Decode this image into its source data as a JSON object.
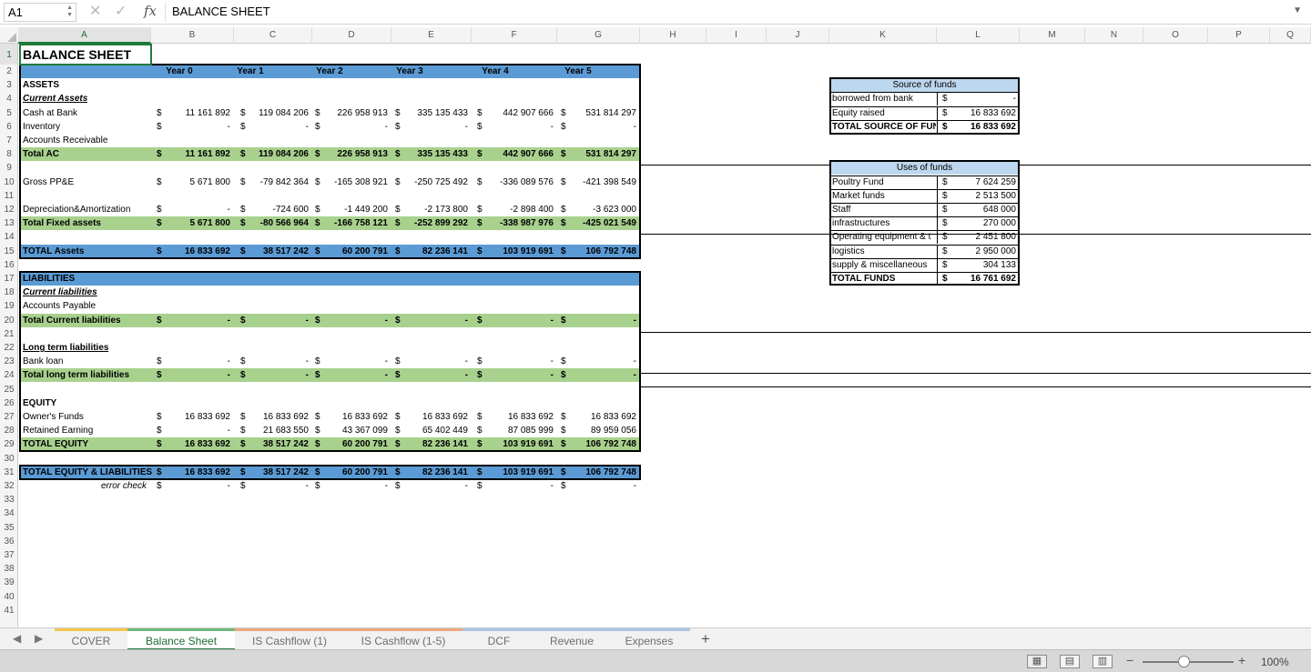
{
  "formula_bar": {
    "cell_ref": "A1",
    "fx": "fx",
    "value": "BALANCE SHEET"
  },
  "columns": [
    "A",
    "B",
    "C",
    "D",
    "E",
    "F",
    "G",
    "H",
    "I",
    "J",
    "K",
    "L",
    "M",
    "N",
    "O",
    "P",
    "Q"
  ],
  "rows": [
    "1",
    "2",
    "3",
    "4",
    "5",
    "6",
    "7",
    "8",
    "9",
    "10",
    "11",
    "12",
    "13",
    "14",
    "15",
    "16",
    "17",
    "18",
    "19",
    "20",
    "21",
    "22",
    "23",
    "24",
    "25",
    "26",
    "27",
    "28",
    "29",
    "30",
    "31",
    "32",
    "33",
    "34",
    "35",
    "36",
    "37",
    "38",
    "39",
    "40",
    "41"
  ],
  "balance_sheet": {
    "title": "BALANCE SHEET",
    "years": [
      "Year 0",
      "Year 1",
      "Year 2",
      "Year 3",
      "Year 4",
      "Year 5"
    ],
    "assets_label": "ASSETS",
    "current_assets_label": "Current Assets",
    "cash": {
      "label": "Cash at Bank",
      "values": [
        "11 161 892",
        "119 084 206",
        "226 958 913",
        "335 135 433",
        "442 907 666",
        "531 814 297"
      ]
    },
    "inventory": {
      "label": "Inventory",
      "values": [
        "-",
        "-",
        "-",
        "-",
        "-",
        "-"
      ]
    },
    "receivable": {
      "label": "Accounts Receivable"
    },
    "total_ac": {
      "label": "Total AC",
      "values": [
        "11 161 892",
        "119 084 206",
        "226 958 913",
        "335 135 433",
        "442 907 666",
        "531 814 297"
      ]
    },
    "gross_ppe": {
      "label": "Gross PP&E",
      "values": [
        "5 671 800",
        "-79 842 364",
        "-165 308 921",
        "-250 725 492",
        "-336 089 576",
        "-421 398 549"
      ]
    },
    "depreciation": {
      "label": "Depreciation&Amortization",
      "values": [
        "-",
        "-724 600",
        "-1 449 200",
        "-2 173 800",
        "-2 898 400",
        "-3 623 000"
      ]
    },
    "total_fixed": {
      "label": "Total Fixed assets",
      "values": [
        "5 671 800",
        "-80 566 964",
        "-166 758 121",
        "-252 899 292",
        "-338 987 976",
        "-425 021 549"
      ]
    },
    "total_assets": {
      "label": "TOTAL Assets",
      "values": [
        "16 833 692",
        "38 517 242",
        "60 200 791",
        "82 236 141",
        "103 919 691",
        "106 792 748"
      ]
    },
    "liabilities_label": "LIABILITIES",
    "current_liabilities_label": "Current liabilities",
    "payable": {
      "label": "Accounts Payable"
    },
    "total_current_liab": {
      "label": "Total Current liabilities",
      "values": [
        "-",
        "-",
        "-",
        "-",
        "-",
        "-"
      ]
    },
    "long_term_label": "Long term liabilities",
    "bank_loan": {
      "label": "Bank loan",
      "values": [
        "-",
        "-",
        "-",
        "-",
        "-",
        "-"
      ]
    },
    "total_long_term": {
      "label": "Total long term liabilities",
      "values": [
        "-",
        "-",
        "-",
        "-",
        "-",
        "-"
      ]
    },
    "equity_label": "EQUITY",
    "owners_funds": {
      "label": "Owner's Funds",
      "values": [
        "16 833 692",
        "16 833 692",
        "16 833 692",
        "16 833 692",
        "16 833 692",
        "16 833 692"
      ]
    },
    "retained": {
      "label": "Retained Earning",
      "values": [
        "-",
        "21 683 550",
        "43 367 099",
        "65 402 449",
        "87 085 999",
        "89 959 056"
      ]
    },
    "total_equity": {
      "label": "TOTAL EQUITY",
      "values": [
        "16 833 692",
        "38 517 242",
        "60 200 791",
        "82 236 141",
        "103 919 691",
        "106 792 748"
      ]
    },
    "total_eq_liab": {
      "label": "TOTAL EQUITY & LIABILITIES",
      "values": [
        "16 833 692",
        "38 517 242",
        "60 200 791",
        "82 236 141",
        "103 919 691",
        "106 792 748"
      ]
    },
    "error_check": {
      "label": "error check",
      "values": [
        "-",
        "-",
        "-",
        "-",
        "-",
        "-"
      ]
    },
    "currency": "$"
  },
  "source_of_funds": {
    "header": "Source of funds",
    "rows": [
      {
        "label": "borrowed from bank",
        "value": "-"
      },
      {
        "label": "Equity raised",
        "value": "16 833 692"
      },
      {
        "label": "TOTAL SOURCE OF FUNDS",
        "value": "16 833 692"
      }
    ]
  },
  "uses_of_funds": {
    "header": "Uses of funds",
    "rows": [
      {
        "label": "Poultry Fund",
        "value": "7 624 259"
      },
      {
        "label": "Market funds",
        "value": "2 513 500"
      },
      {
        "label": "Staff",
        "value": "648 000"
      },
      {
        "label": "infrastructures",
        "value": "270 000"
      },
      {
        "label": "Operating equipment & t",
        "value": "2 451 800"
      },
      {
        "label": "logistics",
        "value": "2 950 000"
      },
      {
        "label": "supply & miscellaneous",
        "value": "304 133"
      },
      {
        "label": "TOTAL FUNDS",
        "value": "16 761 692"
      }
    ]
  },
  "tabs": [
    {
      "label": "COVER",
      "color": "#f5c84c"
    },
    {
      "label": "Balance Sheet",
      "color": "#6fb87a"
    },
    {
      "label": "IS Cashflow (1)",
      "color": "#f0a77a"
    },
    {
      "label": "IS Cashflow (1-5)",
      "color": "#f0a77a"
    },
    {
      "label": "DCF",
      "color": "#a9c4e4"
    },
    {
      "label": "Revenue",
      "color": "#a9c4e4"
    },
    {
      "label": "Expenses",
      "color": "#a9c4e4"
    }
  ],
  "tab_add": "+",
  "zoom": {
    "minus": "−",
    "plus": "+",
    "level": "100%",
    "fraction": 0.45
  },
  "colors": {
    "blue_fill": "#5b9bd5",
    "green_fill": "#a9d18e",
    "light_blue": "#bdd7ee",
    "selected_border": "#1f7a3a"
  }
}
